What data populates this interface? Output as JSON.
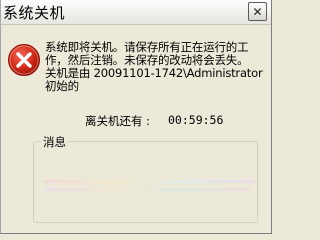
{
  "window": {
    "title": "系统关机",
    "close_glyph": "✕"
  },
  "icon": {
    "name": "error-icon",
    "color": "#d62c1a"
  },
  "message": {
    "lines": [
      "系统即将关机。请保存所有正在运行的工",
      "作，然后注销。未保存的改动将会丢失。",
      "关机是由 20091101-1742\\Administrator",
      "初始的"
    ]
  },
  "countdown": {
    "label": "离关机还有 :",
    "time": "00:59:56"
  },
  "message_group": {
    "legend": "消息"
  }
}
